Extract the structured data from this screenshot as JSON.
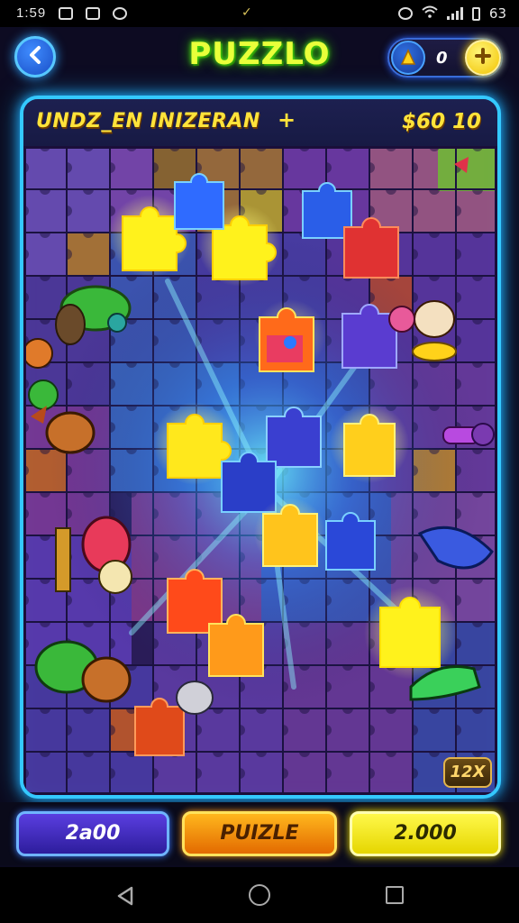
{
  "status_bar": {
    "time": "1:59",
    "battery_text": "63"
  },
  "header": {
    "title": "PUZZLO",
    "coins": "0"
  },
  "panel": {
    "level_name": "UNDZ_EN INIZERAN",
    "level_plus": "+",
    "prize": "$60 10",
    "counter": "12X"
  },
  "buttons": {
    "left": "2a00",
    "middle": "PUIZLE",
    "right": "2.000"
  },
  "icons": {
    "back": "chevron-left-icon",
    "coin": "coin-icon",
    "add": "plus-icon",
    "nav_back": "triangle-back-icon",
    "nav_home": "circle-home-icon",
    "nav_recent": "square-recent-icon"
  },
  "colors": {
    "accent_cyan": "#34c9ff",
    "title_green": "#e9ff3a",
    "glow_yellow": "#ffe33a"
  }
}
